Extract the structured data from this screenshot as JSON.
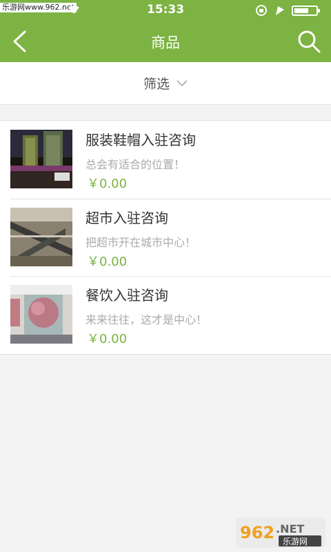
{
  "status_bar": {
    "watermark_top": "乐游网www.962.net",
    "time": "15:33"
  },
  "nav": {
    "title": "商品",
    "back_icon": "chevron-left-icon",
    "search_icon": "search-icon"
  },
  "filter": {
    "label": "筛选",
    "icon": "chevron-down-icon"
  },
  "products": [
    {
      "title": "服装鞋帽入驻咨询",
      "desc": "总会有适合的位置！",
      "price": "￥0.00"
    },
    {
      "title": "超市入驻咨询",
      "desc": "把超市开在城市中心！",
      "price": "￥0.00"
    },
    {
      "title": "餐饮入驻咨询",
      "desc": "来来往往，这才是中心！",
      "price": "￥0.00"
    }
  ],
  "watermark_bottom": {
    "brand_text": "962.NET",
    "sub_text": "乐游网"
  },
  "colors": {
    "accent": "#7cb342",
    "background": "#f3f3f3"
  }
}
